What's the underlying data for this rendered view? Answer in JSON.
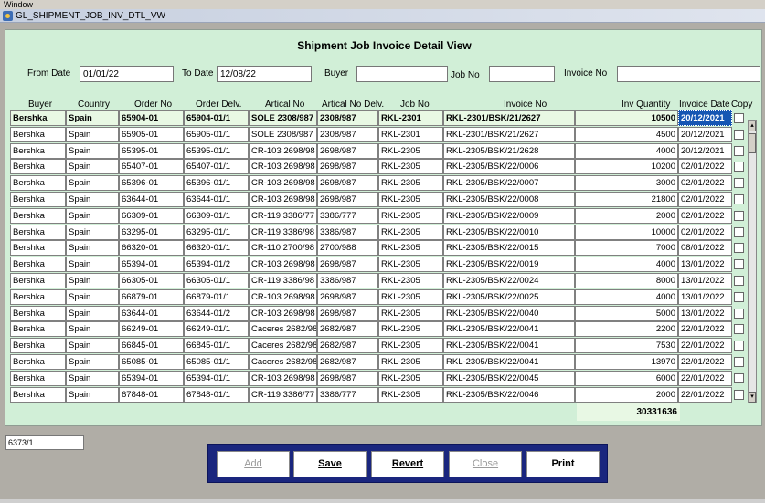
{
  "menu": {
    "label": "Window"
  },
  "window": {
    "title": "GL_SHIPMENT_JOB_INV_DTL_VW"
  },
  "panel": {
    "title": "Shipment Job  Invoice  Detail View"
  },
  "filters": {
    "from_date_label": "From Date",
    "from_date_value": "01/01/22",
    "to_date_label": "To Date",
    "to_date_value": "12/08/22",
    "buyer_label": "Buyer",
    "buyer_value": "",
    "job_no_label": "Job No",
    "job_no_value": "",
    "invoice_no_label": "Invoice No",
    "invoice_no_value": ""
  },
  "columns": [
    "Buyer",
    "Country",
    "Order No",
    "Order Delv.",
    "Artical No",
    "Artical No Delv.",
    "Job No",
    "Invoice No",
    "Inv Quantity",
    "Invoice Date",
    "Copy"
  ],
  "rows": [
    [
      "Bershka",
      "Spain",
      "65904-01",
      "65904-01/1",
      "SOLE 2308/987",
      "2308/987",
      "RKL-2301",
      "RKL-2301/BSK/21/2627",
      "10500",
      "20/12/2021"
    ],
    [
      "Bershka",
      "Spain",
      "65905-01",
      "65905-01/1",
      "SOLE 2308/987",
      "2308/987",
      "RKL-2301",
      "RKL-2301/BSK/21/2627",
      "4500",
      "20/12/2021"
    ],
    [
      "Bershka",
      "Spain",
      "65395-01",
      "65395-01/1",
      "CR-103 2698/98",
      "2698/987",
      "RKL-2305",
      "RKL-2305/BSK/21/2628",
      "4000",
      "20/12/2021"
    ],
    [
      "Bershka",
      "Spain",
      "65407-01",
      "65407-01/1",
      "CR-103 2698/98",
      "2698/987",
      "RKL-2305",
      "RKL-2305/BSK/22/0006",
      "10200",
      "02/01/2022"
    ],
    [
      "Bershka",
      "Spain",
      "65396-01",
      "65396-01/1",
      "CR-103 2698/98",
      "2698/987",
      "RKL-2305",
      "RKL-2305/BSK/22/0007",
      "3000",
      "02/01/2022"
    ],
    [
      "Bershka",
      "Spain",
      "63644-01",
      "63644-01/1",
      "CR-103 2698/98",
      "2698/987",
      "RKL-2305",
      "RKL-2305/BSK/22/0008",
      "21800",
      "02/01/2022"
    ],
    [
      "Bershka",
      "Spain",
      "66309-01",
      "66309-01/1",
      "CR-119 3386/77",
      "3386/777",
      "RKL-2305",
      "RKL-2305/BSK/22/0009",
      "2000",
      "02/01/2022"
    ],
    [
      "Bershka",
      "Spain",
      "63295-01",
      "63295-01/1",
      "CR-119 3386/98",
      "3386/987",
      "RKL-2305",
      "RKL-2305/BSK/22/0010",
      "10000",
      "02/01/2022"
    ],
    [
      "Bershka",
      "Spain",
      "66320-01",
      "66320-01/1",
      "CR-110 2700/98",
      "2700/988",
      "RKL-2305",
      "RKL-2305/BSK/22/0015",
      "7000",
      "08/01/2022"
    ],
    [
      "Bershka",
      "Spain",
      "65394-01",
      "65394-01/2",
      "CR-103 2698/98",
      "2698/987",
      "RKL-2305",
      "RKL-2305/BSK/22/0019",
      "4000",
      "13/01/2022"
    ],
    [
      "Bershka",
      "Spain",
      "66305-01",
      "66305-01/1",
      "CR-119 3386/98",
      "3386/987",
      "RKL-2305",
      "RKL-2305/BSK/22/0024",
      "8000",
      "13/01/2022"
    ],
    [
      "Bershka",
      "Spain",
      "66879-01",
      "66879-01/1",
      "CR-103 2698/98",
      "2698/987",
      "RKL-2305",
      "RKL-2305/BSK/22/0025",
      "4000",
      "13/01/2022"
    ],
    [
      "Bershka",
      "Spain",
      "63644-01",
      "63644-01/2",
      "CR-103 2698/98",
      "2698/987",
      "RKL-2305",
      "RKL-2305/BSK/22/0040",
      "5000",
      "13/01/2022"
    ],
    [
      "Bershka",
      "Spain",
      "66249-01",
      "66249-01/1",
      "Caceres 2682/98",
      "2682/987",
      "RKL-2305",
      "RKL-2305/BSK/22/0041",
      "2200",
      "22/01/2022"
    ],
    [
      "Bershka",
      "Spain",
      "66845-01",
      "66845-01/1",
      "Caceres 2682/98",
      "2682/987",
      "RKL-2305",
      "RKL-2305/BSK/22/0041",
      "7530",
      "22/01/2022"
    ],
    [
      "Bershka",
      "Spain",
      "65085-01",
      "65085-01/1",
      "Caceres 2682/98",
      "2682/987",
      "RKL-2305",
      "RKL-2305/BSK/22/0041",
      "13970",
      "22/01/2022"
    ],
    [
      "Bershka",
      "Spain",
      "65394-01",
      "65394-01/1",
      "CR-103 2698/98",
      "2698/987",
      "RKL-2305",
      "RKL-2305/BSK/22/0045",
      "6000",
      "22/01/2022"
    ],
    [
      "Bershka",
      "Spain",
      "67848-01",
      "67848-01/1",
      "CR-119 3386/77",
      "3386/777",
      "RKL-2305",
      "RKL-2305/BSK/22/0046",
      "2000",
      "22/01/2022"
    ]
  ],
  "total": {
    "value": "30331636"
  },
  "status": {
    "value": "6373/1"
  },
  "buttons": {
    "add": "Add",
    "save": "Save",
    "revert": "Revert",
    "close": "Close",
    "print": "Print"
  },
  "icons": {
    "app": "app-icon",
    "scroll_up": "scroll-up-icon",
    "scroll_down": "scroll-down-icon"
  },
  "colors": {
    "panel_bg": "#d1efd7",
    "button_bar": "#1a267e",
    "selection": "#1656b3",
    "frame": "#b0ada6"
  }
}
